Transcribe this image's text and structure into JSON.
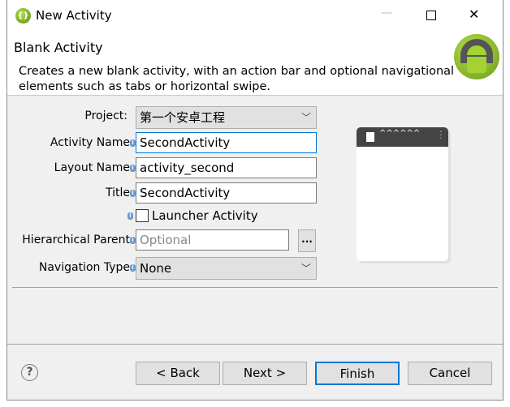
{
  "window": {
    "title": "New Activity",
    "minimize": "—",
    "maximize": "☐",
    "close": "✕"
  },
  "header": {
    "title": "Blank Activity",
    "description": "Creates a new blank activity, with an action bar and optional navigational elements such as tabs or horizontal swipe."
  },
  "form": {
    "project_label": "Project:",
    "project_value": "第一个安卓工程",
    "activity_name_label": "Activity Name",
    "activity_name_value": "SecondActivity",
    "layout_name_label": "Layout Name",
    "layout_name_value": "activity_second",
    "title_label": "Title",
    "title_value": "SecondActivity",
    "launcher_label": "Launcher Activity",
    "launcher_checked": false,
    "parent_label": "Hierarchical Parent",
    "parent_placeholder": "Optional",
    "browse_label": "...",
    "nav_label": "Navigation Type",
    "nav_value": "None"
  },
  "buttons": {
    "back": "< Back",
    "next": "Next >",
    "finish": "Finish",
    "cancel": "Cancel"
  },
  "icons": {
    "app": "android-adt-icon",
    "header": "android-robot-icon",
    "help": "question-icon"
  }
}
